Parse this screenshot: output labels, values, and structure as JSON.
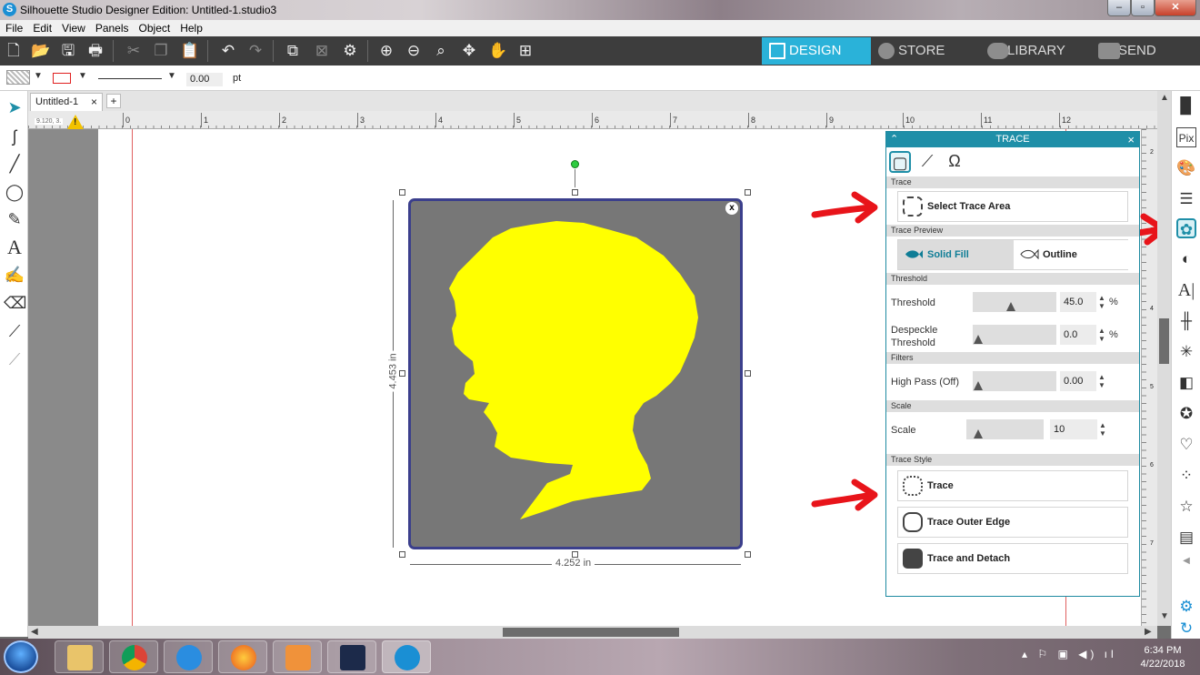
{
  "window": {
    "title": "Silhouette Studio Designer Edition: Untitled-1.studio3",
    "controls": [
      "–",
      "▫",
      "✕"
    ]
  },
  "menu": [
    "File",
    "Edit",
    "View",
    "Panels",
    "Object",
    "Help"
  ],
  "nav_tabs": {
    "design": "DESIGN",
    "store": "STORE",
    "library": "LIBRARY",
    "send": "SEND"
  },
  "properties": {
    "line_width": "0.00",
    "line_unit": "pt"
  },
  "document": {
    "tab_label": "Untitled-1",
    "tab_close": "×",
    "new_tab": "+",
    "coordinates": "9.120, 3.",
    "warning": "!"
  },
  "ruler": {
    "horizontal": [
      "0",
      "1",
      "2",
      "3",
      "4",
      "5",
      "6",
      "7",
      "8",
      "9",
      "10",
      "11",
      "12"
    ],
    "vertical": [
      "2",
      "3",
      "4",
      "5",
      "6",
      "7"
    ]
  },
  "selection": {
    "width_label": "4.252 in",
    "height_label": "4.453 in",
    "delete_label": "x"
  },
  "trace_panel": {
    "title": "TRACE",
    "sections": {
      "trace": "Trace",
      "preview": "Trace Preview",
      "threshold": "Threshold",
      "filters": "Filters",
      "scale": "Scale",
      "style": "Trace Style"
    },
    "select_area_label": "Select Trace Area",
    "preview": {
      "solid": "Solid Fill",
      "outline": "Outline"
    },
    "threshold": {
      "label": "Threshold",
      "value": "45.0",
      "unit": "%",
      "level": 45
    },
    "despeckle": {
      "label_line1": "Despeckle",
      "label_line2": "Threshold",
      "value": "0.0",
      "unit": "%",
      "level": 0
    },
    "high_pass": {
      "label": "High Pass (Off)",
      "value": "0.00",
      "level": 0
    },
    "scale": {
      "label": "Scale",
      "value": "10",
      "level": 10
    },
    "styles": {
      "trace": "Trace",
      "outer_edge": "Trace Outer Edge",
      "detach": "Trace and Detach"
    }
  },
  "taskbar": {
    "time": "6:34 PM",
    "date": "4/22/2018"
  },
  "colors": {
    "accent": "#1f8fa8",
    "design_tab": "#2ab2d9",
    "annotation_arrow": "#e8141a",
    "image_background": "#777777",
    "silhouette": "#ffff00",
    "selection_border": "#3b3f8c"
  }
}
